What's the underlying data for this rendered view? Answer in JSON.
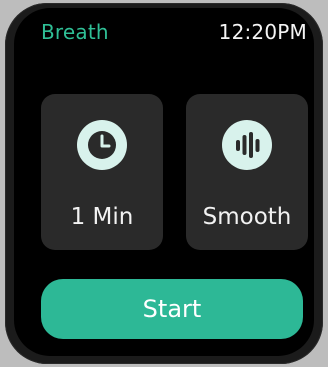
{
  "status_bar": {
    "app_title": "Breath",
    "time": "12:20PM"
  },
  "settings": {
    "duration": {
      "icon": "clock-icon",
      "label": "1 Min"
    },
    "pattern": {
      "icon": "sound-wave-icon",
      "label": "Smooth"
    }
  },
  "actions": {
    "start_label": "Start"
  },
  "colors": {
    "accent": "#2db896",
    "title": "#2fbf96",
    "card_bg": "#2a2a2a",
    "icon_bg": "#d8f2ec",
    "icon_fg": "#2a2a2a"
  }
}
